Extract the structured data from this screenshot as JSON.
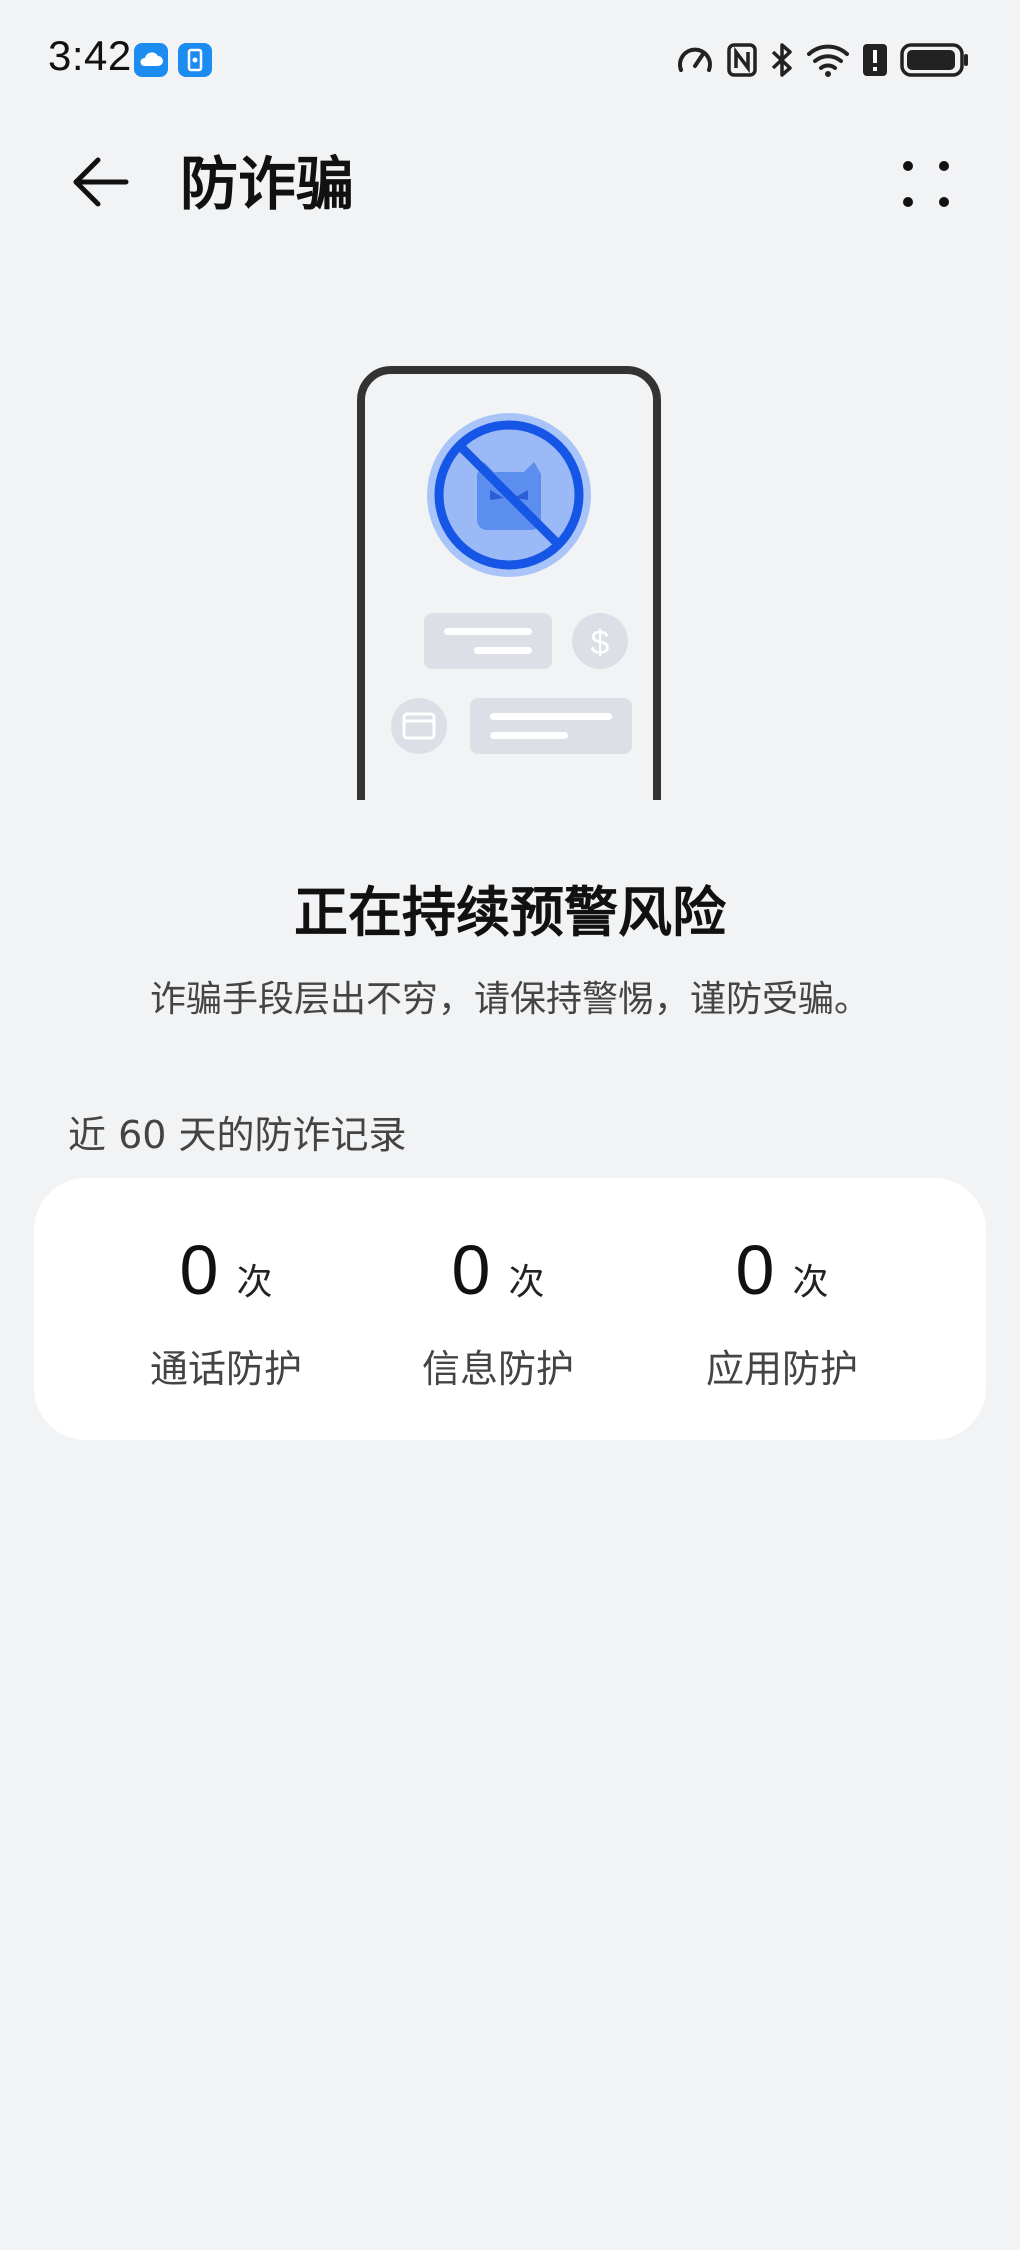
{
  "status_bar": {
    "time": "3:42",
    "left_icons": [
      "cloud-icon",
      "phone-clone-icon"
    ],
    "right_icons": [
      "speed-meter-icon",
      "nfc-icon",
      "bluetooth-icon",
      "wifi-icon",
      "alert-icon",
      "battery-icon"
    ]
  },
  "header": {
    "title": "防诈骗",
    "back_icon": "back-arrow-icon",
    "more_icon": "more-dots-icon"
  },
  "hero": {
    "headline": "正在持续预警风险",
    "subline": "诈骗手段层出不穷，请保持警惕，谨防受骗。",
    "currency_symbol": "$"
  },
  "records": {
    "section_label": "近 60 天的防诈记录",
    "stats": [
      {
        "value": "0",
        "unit": "次",
        "label": "通话防护"
      },
      {
        "value": "0",
        "unit": "次",
        "label": "信息防护"
      },
      {
        "value": "0",
        "unit": "次",
        "label": "应用防护"
      }
    ]
  },
  "colors": {
    "background": "#f1f3f5",
    "card": "#ffffff",
    "accent_blue": "#1f5fe0",
    "light_blue": "#9fbdf6",
    "placeholder_gray": "#dcdfe6"
  }
}
